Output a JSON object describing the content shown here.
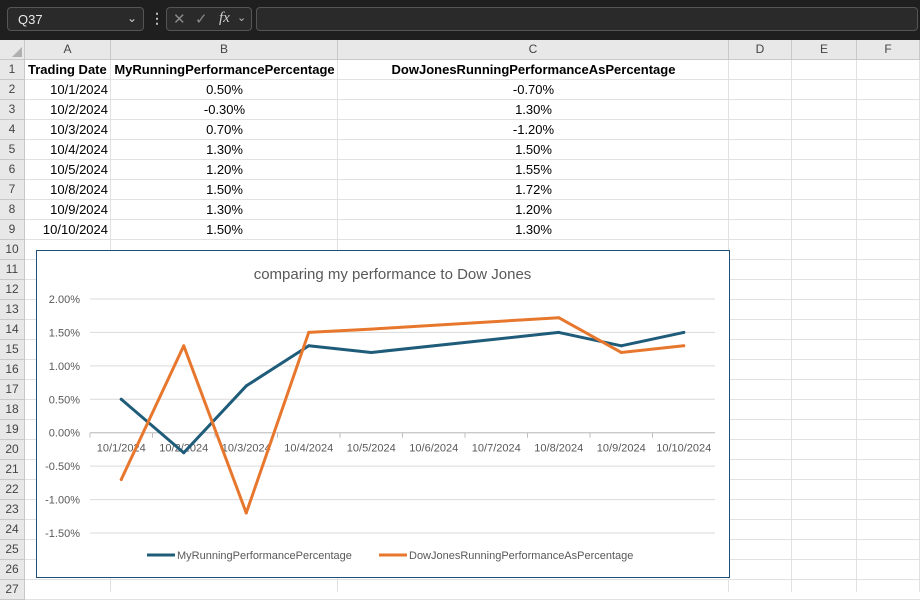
{
  "formula_bar": {
    "name_box": "Q37",
    "fx_label": "fx",
    "formula": ""
  },
  "columns": [
    "A",
    "B",
    "C",
    "D",
    "E",
    "F"
  ],
  "rows": [
    "1",
    "2",
    "3",
    "4",
    "5",
    "6",
    "7",
    "8",
    "9",
    "10",
    "11",
    "12",
    "13",
    "14",
    "15",
    "16",
    "17",
    "18",
    "19",
    "20",
    "21",
    "22",
    "23",
    "24",
    "25",
    "26",
    "27"
  ],
  "table": {
    "headers": [
      "Trading Date",
      "MyRunningPerformancePercentage",
      "DowJonesRunningPerformanceAsPercentage"
    ],
    "rows": [
      [
        "10/1/2024",
        "0.50%",
        "-0.70%"
      ],
      [
        "10/2/2024",
        "-0.30%",
        "1.30%"
      ],
      [
        "10/3/2024",
        "0.70%",
        "-1.20%"
      ],
      [
        "10/4/2024",
        "1.30%",
        "1.50%"
      ],
      [
        "10/5/2024",
        "1.20%",
        "1.55%"
      ],
      [
        "10/8/2024",
        "1.50%",
        "1.72%"
      ],
      [
        "10/9/2024",
        "1.30%",
        "1.20%"
      ],
      [
        "10/10/2024",
        "1.50%",
        "1.30%"
      ]
    ]
  },
  "chart_data": {
    "type": "line",
    "title": "comparing my performance to Dow Jones",
    "categories": [
      "10/1/2024",
      "10/2/2024",
      "10/3/2024",
      "10/4/2024",
      "10/5/2024",
      "10/6/2024",
      "10/7/2024",
      "10/8/2024",
      "10/9/2024",
      "10/10/2024"
    ],
    "x_dates": [
      "2024-10-01",
      "2024-10-02",
      "2024-10-03",
      "2024-10-04",
      "2024-10-05",
      "2024-10-08",
      "2024-10-09",
      "2024-10-10"
    ],
    "series": [
      {
        "name": "MyRunningPerformancePercentage",
        "color": "#1f5c7a",
        "values": [
          0.5,
          -0.3,
          0.7,
          1.3,
          1.2,
          1.5,
          1.3,
          1.5
        ]
      },
      {
        "name": "DowJonesRunningPerformanceAsPercentage",
        "color": "#e8772e",
        "values": [
          -0.7,
          1.3,
          -1.2,
          1.5,
          1.55,
          1.72,
          1.2,
          1.3
        ]
      }
    ],
    "y_ticks": [
      "2.00%",
      "1.50%",
      "1.00%",
      "0.50%",
      "0.00%",
      "-0.50%",
      "-1.00%",
      "-1.50%"
    ],
    "ylim": [
      -1.5,
      2.0
    ],
    "grid": true,
    "legend": "bottom"
  }
}
